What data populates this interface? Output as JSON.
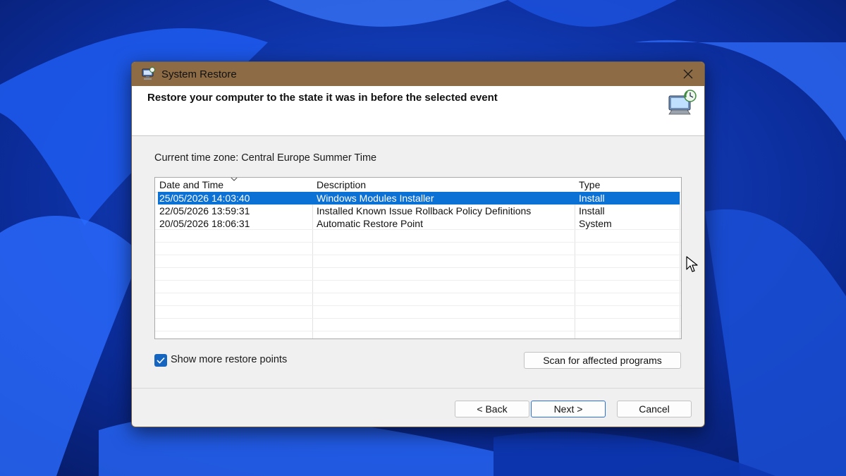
{
  "window": {
    "title": "System Restore",
    "icon": "system-restore-icon",
    "close_icon": "close-icon"
  },
  "header": {
    "text": "Restore your computer to the state it was in before the selected event",
    "icon": "restore-computer-icon"
  },
  "timezone_label": "Current time zone: Central Europe Summer Time",
  "list": {
    "columns": [
      "Date and Time",
      "Description",
      "Type"
    ],
    "sorted_column": "Date and Time",
    "rows": [
      {
        "date": "25/05/2026 14:03:40",
        "description": "Windows Modules Installer",
        "type": "Install",
        "selected": true
      },
      {
        "date": "22/05/2026 13:59:31",
        "description": "Installed Known Issue Rollback Policy Definitions",
        "type": "Install",
        "selected": false
      },
      {
        "date": "20/05/2026 18:06:31",
        "description": "Automatic Restore Point",
        "type": "System",
        "selected": false
      }
    ]
  },
  "show_more": {
    "label": "Show more restore points",
    "checked": true
  },
  "buttons": {
    "scan": "Scan for affected programs",
    "back": "< Back",
    "next": "Next >",
    "cancel": "Cancel"
  },
  "colors": {
    "titlebar": "#8d6b45",
    "selection": "#0c71d4",
    "accent": "#1565c0"
  }
}
